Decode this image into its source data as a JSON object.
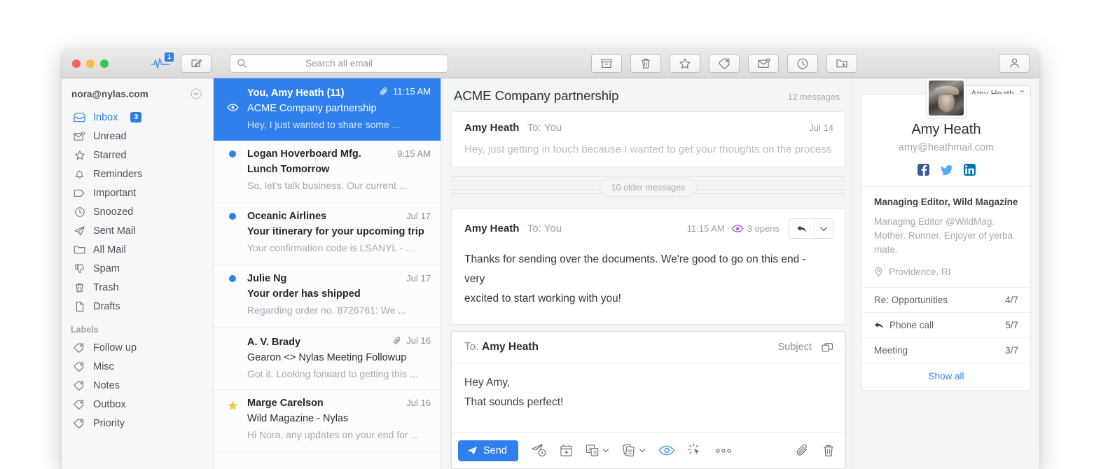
{
  "titlebar": {
    "activity_badge": "1",
    "search": {
      "value": "",
      "placeholder": "Search all email"
    },
    "buttons": [
      {
        "name": "archive",
        "icon": "archive-icon"
      },
      {
        "name": "trash",
        "icon": "trash-icon"
      },
      {
        "name": "star",
        "icon": "star-icon"
      },
      {
        "name": "label",
        "icon": "tag-icon"
      },
      {
        "name": "mark-unread",
        "icon": "mail-unread-icon"
      },
      {
        "name": "snooze",
        "icon": "clock-icon"
      },
      {
        "name": "move-to-folder",
        "icon": "folder-move-icon"
      }
    ]
  },
  "sidebar": {
    "account": "nora@nylas.com",
    "items": [
      {
        "label": "Inbox",
        "icon": "inbox-icon",
        "badge": "3",
        "active": true
      },
      {
        "label": "Unread",
        "icon": "envelope-unread-icon"
      },
      {
        "label": "Starred",
        "icon": "star-icon"
      },
      {
        "label": "Reminders",
        "icon": "bell-icon"
      },
      {
        "label": "Important",
        "icon": "tag-outline-icon"
      },
      {
        "label": "Snoozed",
        "icon": "clock-icon"
      },
      {
        "label": "Sent Mail",
        "icon": "paper-plane-icon"
      },
      {
        "label": "All Mail",
        "icon": "folder-icon"
      },
      {
        "label": "Spam",
        "icon": "thumbs-down-icon"
      },
      {
        "label": "Trash",
        "icon": "trash-icon"
      },
      {
        "label": "Drafts",
        "icon": "document-icon"
      }
    ],
    "labels_header": "Labels",
    "labels": [
      {
        "label": "Follow up",
        "icon": "tag-icon"
      },
      {
        "label": "Misc",
        "icon": "tag-icon"
      },
      {
        "label": "Notes",
        "icon": "tag-icon"
      },
      {
        "label": "Outbox",
        "icon": "tag-icon"
      },
      {
        "label": "Priority",
        "icon": "tag-icon"
      }
    ]
  },
  "mail_list": [
    {
      "from": "You, Amy Heath (11)",
      "subject": "ACME Company partnership",
      "snippet": "Hey, I just wanted to share some ...",
      "date": "11:15 AM",
      "selected": true,
      "attachment": true,
      "gutter_icon": "eye-icon"
    },
    {
      "from": "Logan Hoverboard Mfg.",
      "subject": "Lunch Tomorrow",
      "snippet": "So, let's talk business. Our current ...",
      "date": "9:15 AM",
      "unread": true,
      "gutter_icon": "unread-dot-icon"
    },
    {
      "from": "Oceanic Airlines",
      "subject": "Your itinerary for your upcoming trip",
      "snippet": "Your confirmation code is LSANYL - ...",
      "date": "Jul 17",
      "unread": true,
      "gutter_icon": "unread-dot-icon"
    },
    {
      "from": "Julie Ng",
      "subject": "Your order has shipped",
      "snippet": "Regarding order no. 8726761: We ...",
      "date": "Jul 17",
      "unread": true,
      "gutter_icon": "unread-dot-icon"
    },
    {
      "from": "A. V. Brady",
      "subject": "Gearon <> Nylas Meeting Followup",
      "snippet": "Got it. Looking forward to getting this ...",
      "date": "Jul 16",
      "attachment": true,
      "gutter_icon": "none"
    },
    {
      "from": "Marge Carelson",
      "subject": "Wild Magazine - Nylas",
      "snippet": "Hi Nora, any updates on your end for ...",
      "date": "Jul 16",
      "gutter_icon": "star-filled-icon"
    }
  ],
  "thread": {
    "title": "ACME Company partnership",
    "count_label": "12 messages",
    "older_pill": "10 older messages",
    "messages": [
      {
        "from": "Amy Heath",
        "to": "To: You",
        "date": "Jul 14",
        "preview": "Hey, just getting in touch because I wanted to get your thoughts on the process",
        "collapsed": true
      },
      {
        "from": "Amy Heath",
        "to": "To: You",
        "date": "11:15 AM",
        "opens": "3 opens",
        "body_line1": "Thanks for sending over the documents. We're good to go on this end - very",
        "body_line2": "excited to start working with you!",
        "collapsed": false
      }
    ]
  },
  "compose": {
    "to_prefix": "To:",
    "to_name": "Amy Heath",
    "subject_label": "Subject",
    "body_line1": "Hey Amy,",
    "body_line2": "That sounds perfect!",
    "send_label": "Send",
    "toolbar_icons": [
      "send-later-icon",
      "schedule-icon",
      "templates-icon",
      "snippets-icon",
      "read-receipts-icon",
      "link-tracking-icon",
      "more-options-icon",
      "attachment-icon",
      "discard-icon"
    ]
  },
  "contact": {
    "selector_value": "Amy Heath",
    "name": "Amy Heath",
    "email": "amy@heathmail.com",
    "socials": [
      "facebook-icon",
      "twitter-icon",
      "linkedin-icon"
    ],
    "role": "Managing Editor, Wild Magazine",
    "bio_line1": "Managing Editor @WildMag.",
    "bio_line2": "Mother. Runner. Enjoyer of yerba mate.",
    "location": "Providence, RI",
    "stats": [
      {
        "label": "Re: Opportunities",
        "value": "4/7",
        "icon": "none"
      },
      {
        "label": "Phone call",
        "value": "5/7",
        "icon": "reply-icon"
      },
      {
        "label": "Meeting",
        "value": "3/7",
        "icon": "none"
      }
    ],
    "show_all": "Show all"
  },
  "colors": {
    "accent": "#2f80ed",
    "badge": "#2f7fe0",
    "star": "#f2c94c",
    "text": "#2b2f35",
    "muted": "#a2a8b0"
  }
}
